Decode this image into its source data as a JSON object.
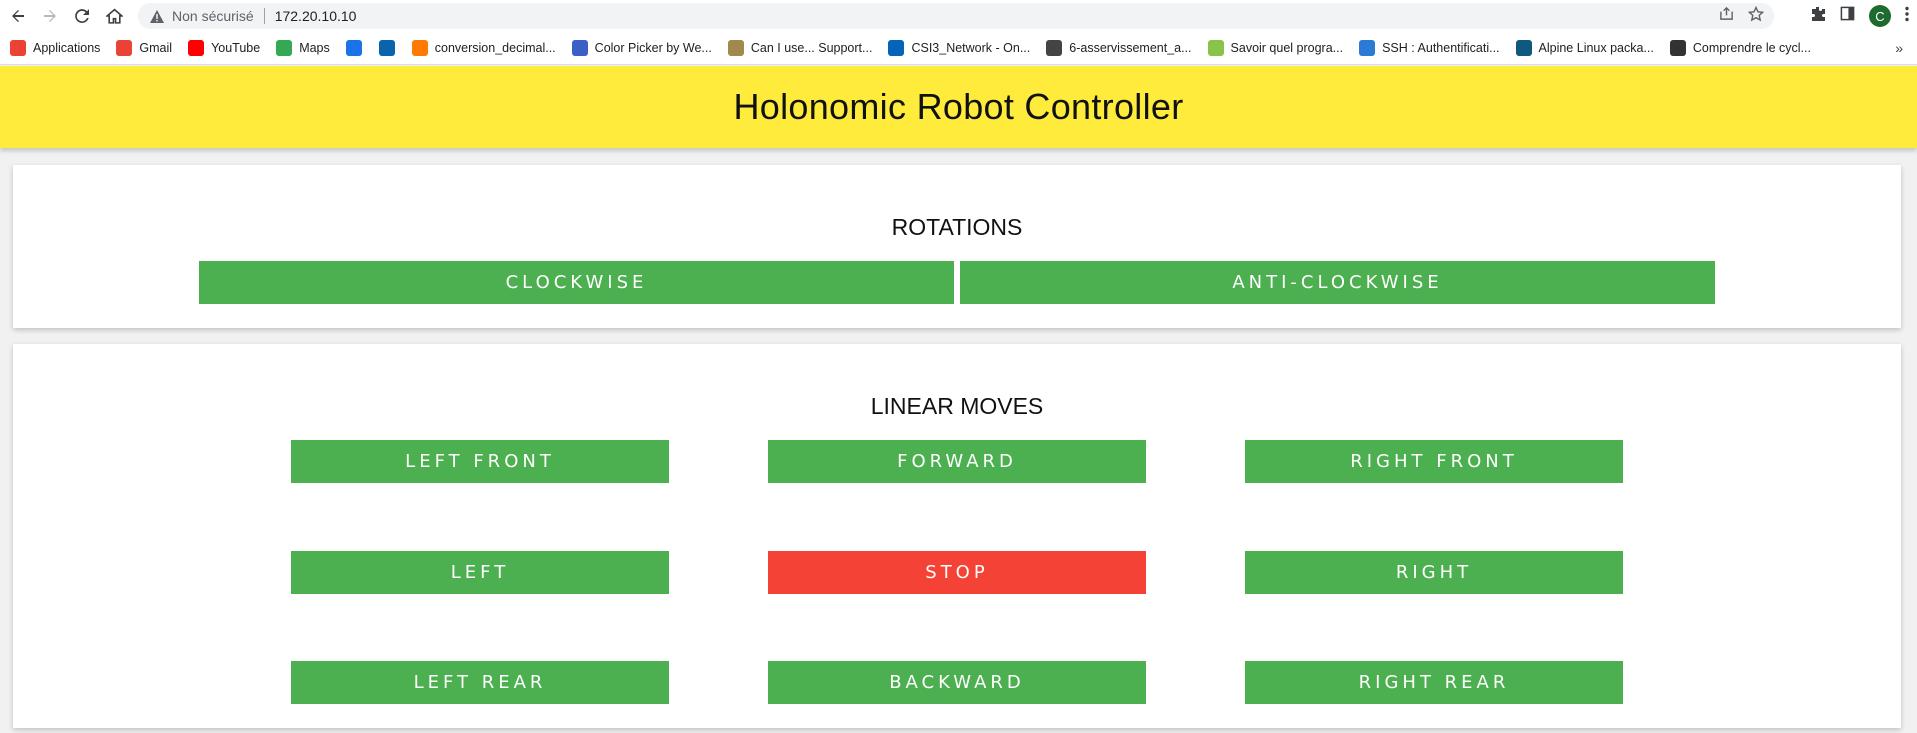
{
  "browser": {
    "security_label": "Non sécurisé",
    "url": "172.20.10.10",
    "avatar_letter": "C",
    "bookmarks": [
      {
        "label": "Applications",
        "icon": "apps-grid-icon",
        "color": "#ea4335"
      },
      {
        "label": "Gmail",
        "icon": "gmail-icon",
        "color": "#ea4335"
      },
      {
        "label": "YouTube",
        "icon": "youtube-icon",
        "color": "#ff0000"
      },
      {
        "label": "Maps",
        "icon": "maps-pin-icon",
        "color": "#34a853"
      },
      {
        "label": "",
        "icon": "kit-icon",
        "color": "#1a73e8"
      },
      {
        "label": "",
        "icon": "outlook-icon",
        "color": "#0a64ad"
      },
      {
        "label": "conversion_decimal...",
        "icon": "orange-icon",
        "color": "#ff7900"
      },
      {
        "label": "Color Picker by We...",
        "icon": "fx-icon",
        "color": "#3b5fc4"
      },
      {
        "label": "Can I use... Support...",
        "icon": "caniuse-icon",
        "color": "#a1884d"
      },
      {
        "label": "CSI3_Network - On...",
        "icon": "onedrive-cloud-icon",
        "color": "#0364b8"
      },
      {
        "label": "6-asservissement_a...",
        "icon": "globe-icon",
        "color": "#444444"
      },
      {
        "label": "Savoir quel progra...",
        "icon": "savoir-icon",
        "color": "#8bc34a"
      },
      {
        "label": "SSH : Authentificati...",
        "icon": "fr-icon",
        "color": "#2b7bd6"
      },
      {
        "label": "Alpine Linux packa...",
        "icon": "alpine-icon",
        "color": "#0d597f"
      },
      {
        "label": "Comprendre le cycl...",
        "icon": "hammer-icon",
        "color": "#333333"
      }
    ],
    "more_label": "»"
  },
  "app": {
    "title": "Holonomic Robot Controller"
  },
  "rotations": {
    "title": "ROTATIONS",
    "clockwise": "CLOCKWISE",
    "anti_clockwise": "ANTI-CLOCKWISE"
  },
  "linear": {
    "title": "LINEAR MOVES",
    "left_front": "LEFT FRONT",
    "forward": "FORWARD",
    "right_front": "RIGHT FRONT",
    "left": "LEFT",
    "stop": "STOP",
    "right": "RIGHT",
    "left_rear": "LEFT REAR",
    "backward": "BACKWARD",
    "right_rear": "RIGHT REAR"
  },
  "colors": {
    "header_bg": "#ffeb3b",
    "button_green": "#4caf50",
    "button_red": "#f44336"
  }
}
